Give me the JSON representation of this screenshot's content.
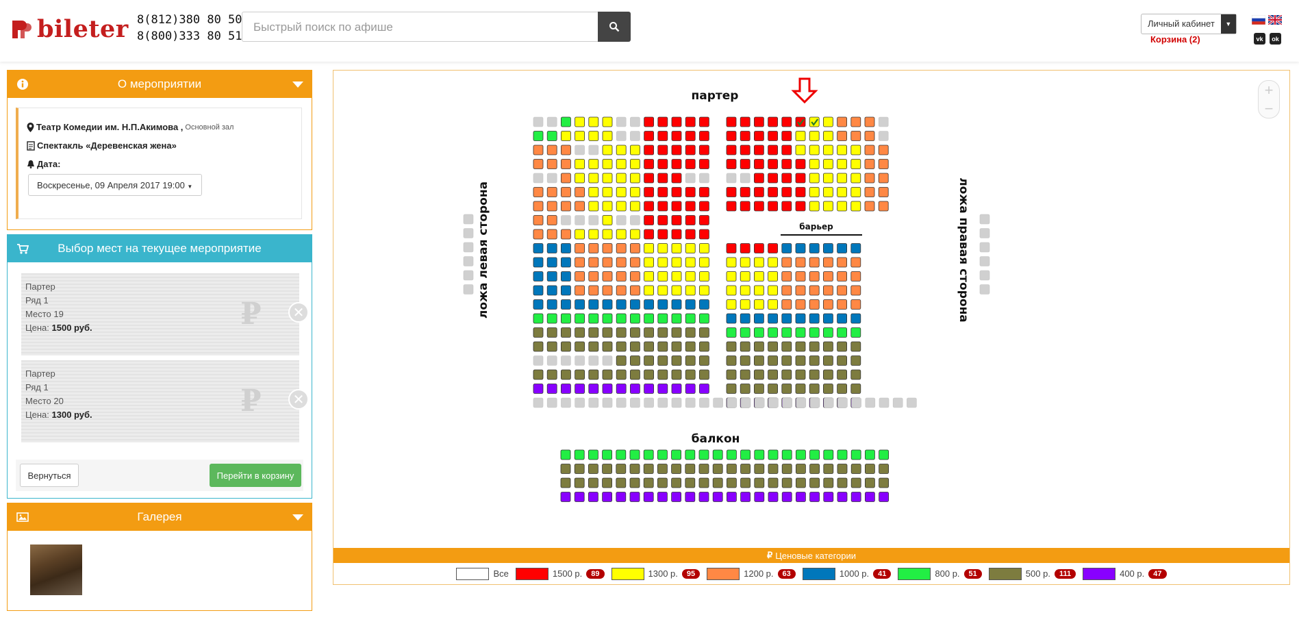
{
  "header": {
    "logo_text": "bileter",
    "phones": [
      "8(812)380 80 50",
      "8(800)333 80 51"
    ],
    "search_placeholder": "Быстрый поиск по афише",
    "cabinet_label": "Личный кабинет",
    "cart_label": "Корзина (2)"
  },
  "about": {
    "title": "О мероприятии",
    "venue": "Театр Комедии им. Н.П.Акимова ,",
    "hall": "Основной зал",
    "show": "Спектакль «Деревенская жена»",
    "date_label": "Дата:",
    "date_value": "Воскресенье, 09 Апреля 2017 19:00"
  },
  "selection": {
    "title": "Выбор мест на текущее мероприятие",
    "price_prefix": "Цена:",
    "tickets": [
      {
        "zone": "Партер",
        "row": "Ряд 1",
        "seat": "Место 19",
        "price": "1500 руб."
      },
      {
        "zone": "Партер",
        "row": "Ряд 1",
        "seat": "Место 20",
        "price": "1300 руб."
      }
    ],
    "back_label": "Вернуться",
    "cart_label": "Перейти в корзину"
  },
  "gallery": {
    "title": "Галерея"
  },
  "seatmap": {
    "labels": {
      "parter": "партер",
      "balcony": "балкон",
      "barrier": "барьер",
      "left_box": "ложа левая сторона",
      "right_box": "ложа правая сторона"
    },
    "price_colors": {
      "1500": "#ff0000",
      "1300": "#ffff00",
      "1200": "#ff8844",
      "1000": "#0077bb",
      "800": "#22ee44",
      "500": "#7d7c3f",
      "400": "#8800ff",
      "sold": "#d0d0d0"
    }
  },
  "legend": {
    "title": "Ценовые категории",
    "items": [
      {
        "label": "Все",
        "color": "#ffffff",
        "count": ""
      },
      {
        "label": "1500 р.",
        "color": "#ff0000",
        "count": "89"
      },
      {
        "label": "1300 р.",
        "color": "#ffff00",
        "count": "95"
      },
      {
        "label": "1200 р.",
        "color": "#ff8844",
        "count": "63"
      },
      {
        "label": "1000 р.",
        "color": "#0077bb",
        "count": "41"
      },
      {
        "label": "800 р.",
        "color": "#22ee44",
        "count": "51"
      },
      {
        "label": "500 р.",
        "color": "#7d7c3f",
        "count": "111"
      },
      {
        "label": "400 р.",
        "color": "#8800ff",
        "count": "47"
      }
    ]
  }
}
